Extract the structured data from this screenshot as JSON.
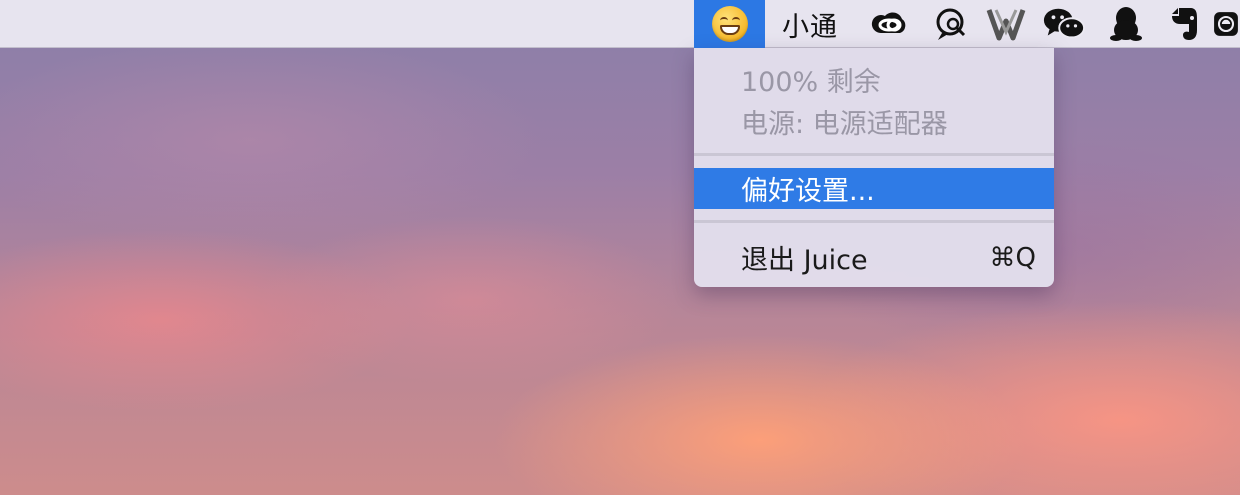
{
  "menubar": {
    "juice_icon": "grinning-face-icon",
    "xiaotong_label": "小通",
    "icons": [
      {
        "name": "creative-cloud-icon"
      },
      {
        "name": "search-bubble-icon"
      },
      {
        "name": "w-logo-icon"
      },
      {
        "name": "wechat-icon"
      },
      {
        "name": "qq-penguin-icon"
      },
      {
        "name": "evernote-icon"
      },
      {
        "name": "partial-app-icon"
      }
    ],
    "accent_color": "#2c78e4"
  },
  "menu": {
    "battery_status": "100% 剩余",
    "power_source": "电源: 电源适配器",
    "preferences_label": "偏好设置...",
    "quit_label": "退出 Juice",
    "quit_shortcut": "⌘Q"
  }
}
